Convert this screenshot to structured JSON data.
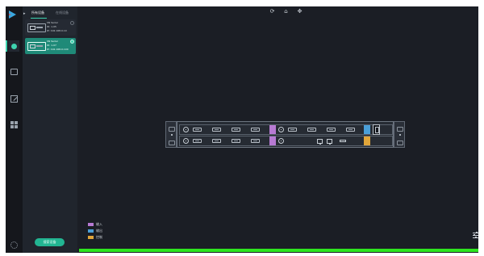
{
  "left_panel": {
    "tabs": [
      {
        "label": "所有设备",
        "selected": true
      },
      {
        "label": "在线设备",
        "selected": false
      }
    ],
    "devices": [
      {
        "name": "SN Serial",
        "line2": "ID: 1-05",
        "line3": "IP: 192.168.0.10",
        "selected": false
      },
      {
        "name": "SN Serial",
        "line2": "ID: 1-07",
        "line3": "IP: 192.168.0.100",
        "selected": true
      }
    ],
    "add_button": "搜索设备"
  },
  "rail": {
    "icons": [
      "dot-icon",
      "screen-icon",
      "edit-icon",
      "grid-icon",
      "gear-icon"
    ],
    "active": "dot-icon",
    "accent_color": "#3ed4b0"
  },
  "toolbar": {
    "icons": [
      "refresh-icon",
      "home-icon",
      "move-icon"
    ],
    "glyphs": [
      "⟳",
      "⌂",
      "✥"
    ]
  },
  "device_panel": {
    "zones": [
      "input",
      "output",
      "control"
    ]
  },
  "legend": [
    {
      "label": "输入",
      "color": "#b77ad3"
    },
    {
      "label": "输出",
      "color": "#4a9fd8"
    },
    {
      "label": "控制",
      "color": "#e1a63a"
    }
  ],
  "progress": {
    "value": 1.0,
    "color": "#2ee51f"
  }
}
